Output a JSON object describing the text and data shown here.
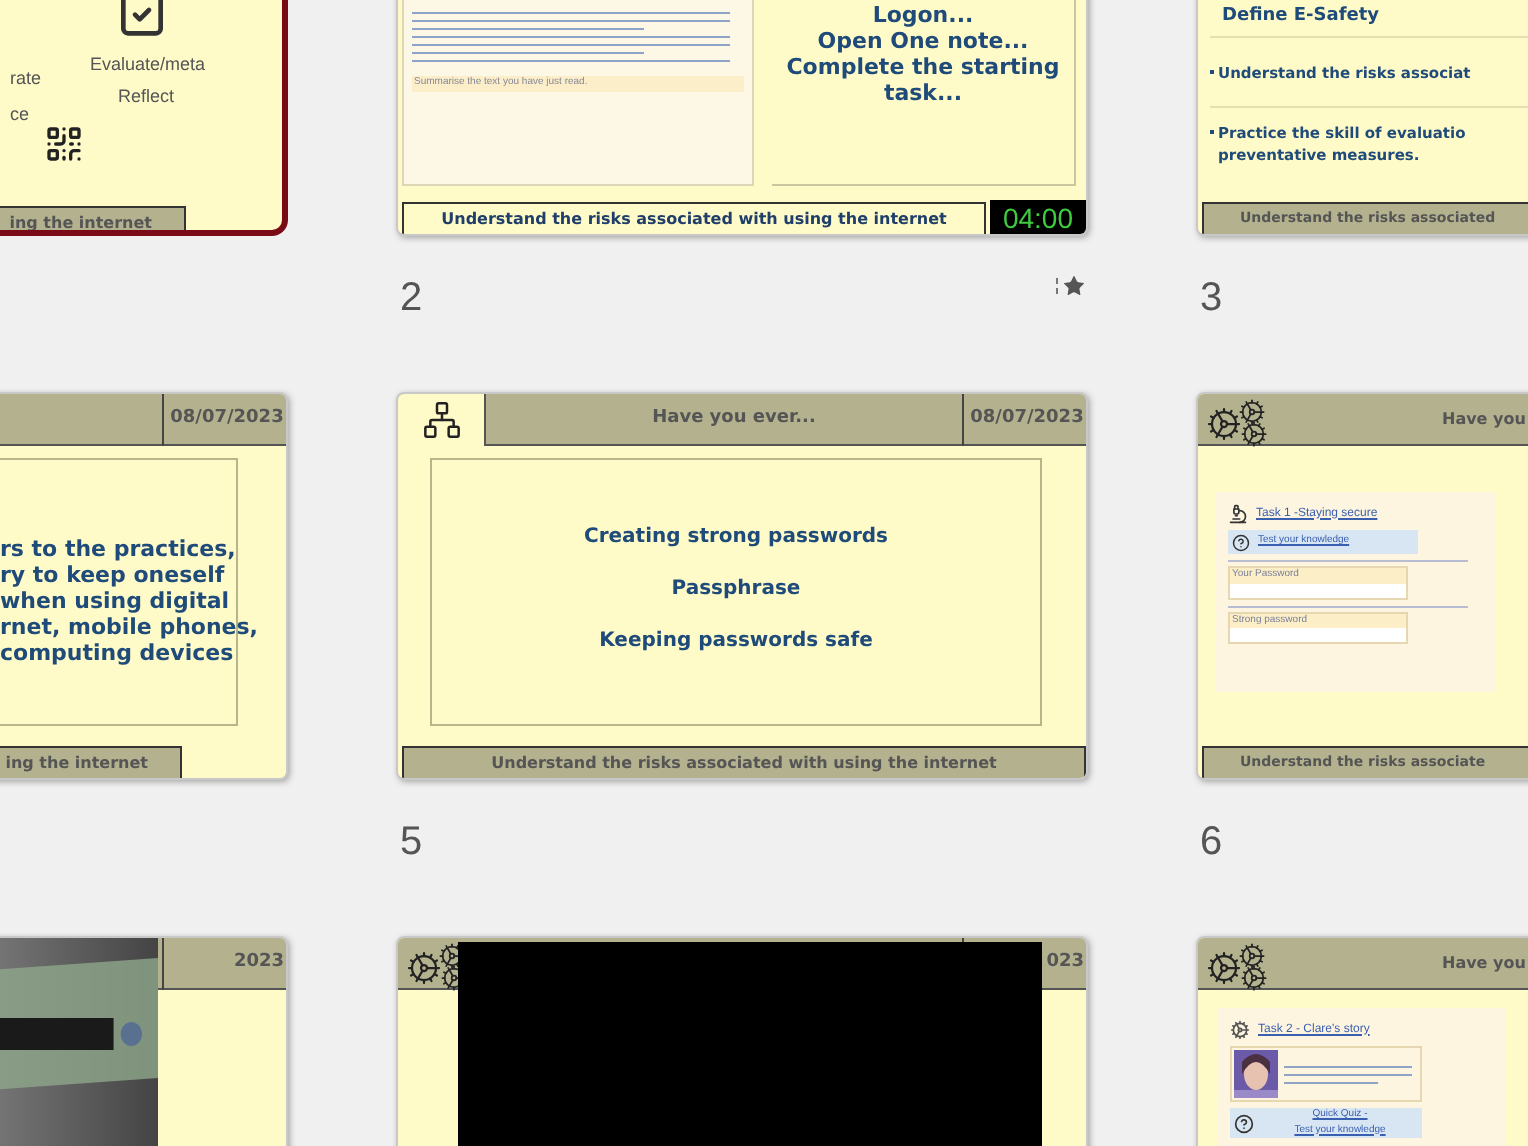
{
  "slides": [
    {
      "kind": "menu",
      "selected": true,
      "labels": [
        "rate",
        "ce"
      ],
      "items": [
        "Evaluate/meta",
        "Reflect"
      ],
      "footer": "ing the internet"
    },
    {
      "kind": "starter",
      "selected": false,
      "number": "2",
      "animated": true,
      "lines": [
        "Logon...",
        "Open One note...",
        "Complete the starting task..."
      ],
      "prompt": "Summarise the text you have just read.",
      "footer": "Understand the risks associated with using the internet",
      "timer": "04:00"
    },
    {
      "kind": "objectives",
      "selected": false,
      "number": "3",
      "title": "Define E-Safety",
      "bullets": [
        "Understand the risks associat",
        "Practice the skill of evaluatio preventative measures."
      ],
      "footer": "Understand the risks associated"
    },
    {
      "kind": "definition",
      "selected": false,
      "date": "08/07/2023",
      "lines": [
        "rs to the practices,",
        "ry to keep oneself",
        "when using digital",
        "rnet, mobile phones,",
        "computing devices"
      ],
      "footer": "ing the internet"
    },
    {
      "kind": "topics",
      "selected": false,
      "number": "5",
      "title": "Have you ever...",
      "date": "08/07/2023",
      "lines": [
        "Creating strong passwords",
        "Passphrase",
        "Keeping passwords safe"
      ],
      "footer": "Understand the risks associated with using the internet"
    },
    {
      "kind": "task",
      "selected": false,
      "number": "6",
      "title": "Have you",
      "task": "Task 1 -Staying secure",
      "link": "Test your knowledge",
      "fields": [
        "Your Password",
        "Strong password"
      ],
      "footer": "Understand the risks associate"
    },
    {
      "kind": "video",
      "selected": false,
      "date": "2023"
    },
    {
      "kind": "blackvideo",
      "selected": false,
      "date": "023"
    },
    {
      "kind": "story",
      "selected": false,
      "title": "Have you",
      "task": "Task 2 - Clare's story",
      "quiz": [
        "Quick Quiz -",
        "Test your knowledge"
      ]
    }
  ]
}
